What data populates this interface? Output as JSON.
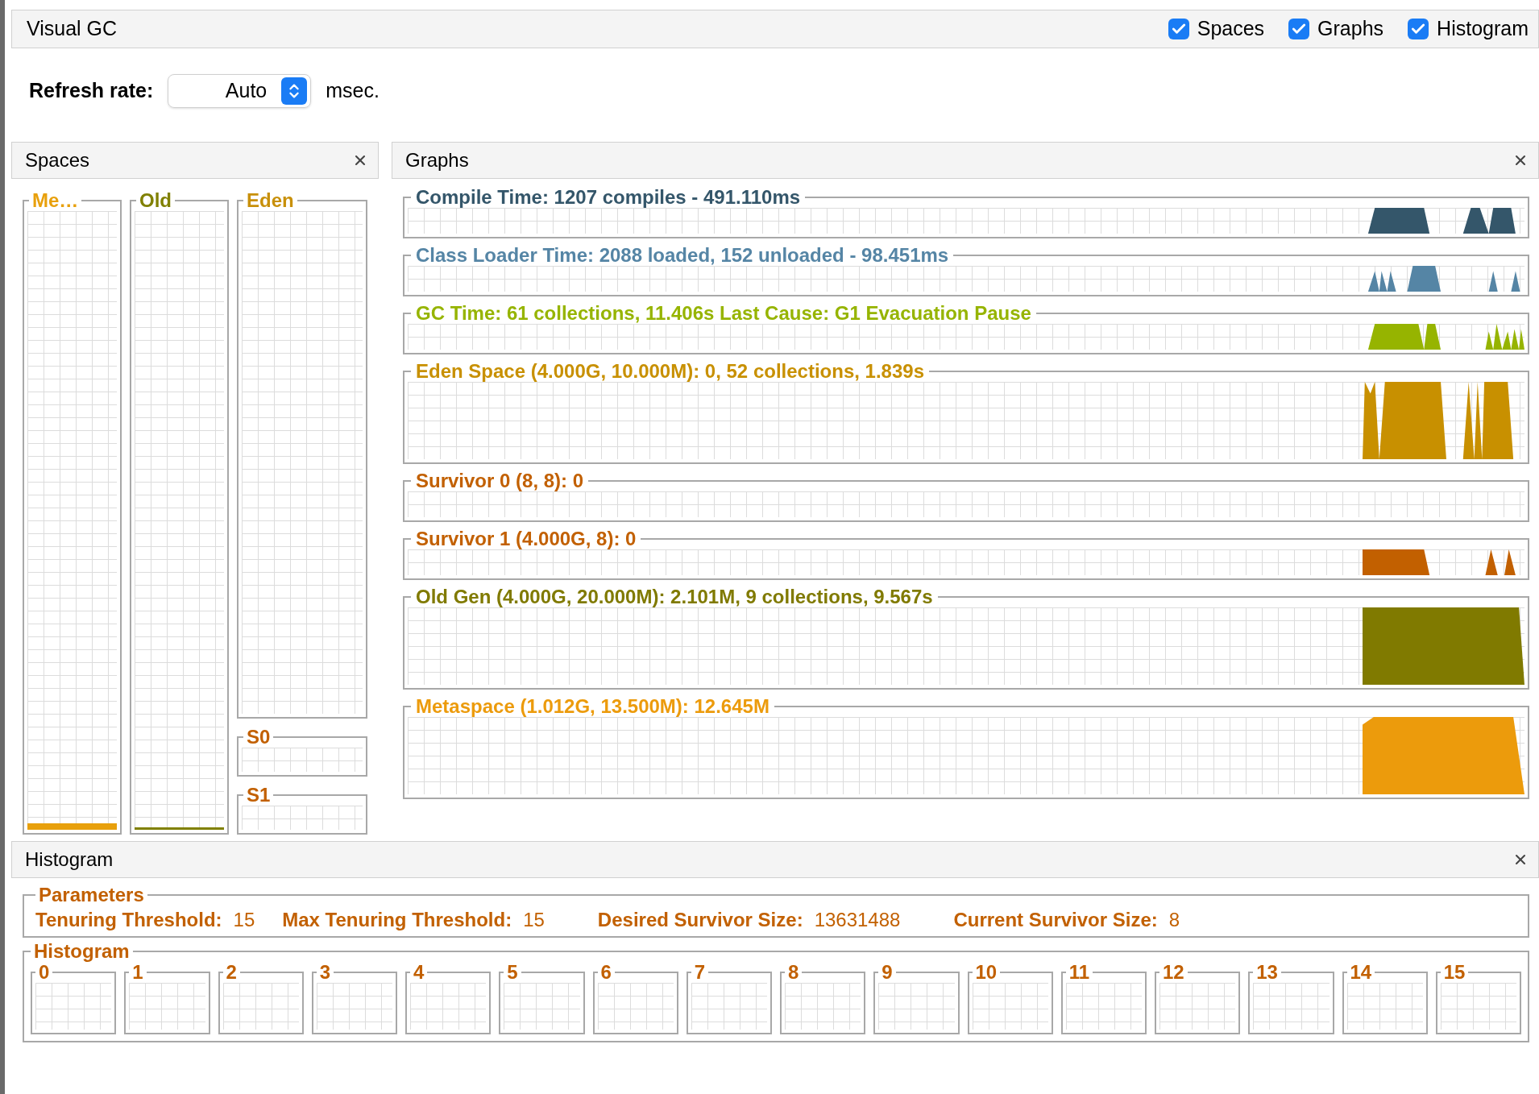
{
  "window": {
    "title": "Visual GC"
  },
  "view_toggles": [
    {
      "label": "Spaces",
      "checked": true
    },
    {
      "label": "Graphs",
      "checked": true
    },
    {
      "label": "Histogram",
      "checked": true
    }
  ],
  "refresh": {
    "label": "Refresh rate:",
    "value": "Auto",
    "unit": "msec."
  },
  "spaces": {
    "title": "Spaces",
    "columns": [
      {
        "name": "Me…",
        "color": "#e8a00c",
        "level": 0.01
      },
      {
        "name": "Old",
        "color": "#808000",
        "level": 0.003
      }
    ],
    "stacked": [
      {
        "name": "Eden",
        "color": "#c8900a"
      },
      {
        "name": "S0",
        "color": "#c26000"
      },
      {
        "name": "S1",
        "color": "#c26000"
      }
    ]
  },
  "graphs": {
    "title": "Graphs",
    "items": [
      {
        "title": "Compile Time: 1207 compiles - 491.110ms",
        "color": "#34566a",
        "kind": "compact"
      },
      {
        "title": "Class Loader Time: 2088 loaded, 152 unloaded - 98.451ms",
        "color": "#5585a5",
        "kind": "compact"
      },
      {
        "title": "GC Time: 61 collections, 11.406s  Last Cause: G1 Evacuation Pause",
        "color": "#96b400",
        "kind": "compact"
      },
      {
        "title": "Eden Space (4.000G, 10.000M): 0, 52 collections, 1.839s",
        "color": "#c89000",
        "kind": "large"
      },
      {
        "title": "Survivor 0 (8, 8): 0",
        "color": "#c26000",
        "kind": "compact"
      },
      {
        "title": "Survivor 1 (4.000G, 8): 0",
        "color": "#c26000",
        "kind": "compact"
      },
      {
        "title": "Old Gen (4.000G, 20.000M): 2.101M, 9 collections, 9.567s",
        "color": "#807a00",
        "kind": "large"
      },
      {
        "title": "Metaspace (1.012G, 13.500M): 12.645M",
        "color": "#ec9b0c",
        "kind": "large"
      }
    ]
  },
  "histogram": {
    "title": "Histogram",
    "parameters_title": "Parameters",
    "parameters": [
      {
        "label": "Tenuring Threshold:",
        "value": "15"
      },
      {
        "label": "Max Tenuring Threshold:",
        "value": "15"
      },
      {
        "label": "Desired Survivor Size:",
        "value": "13631488"
      },
      {
        "label": "Current Survivor Size:",
        "value": "8"
      }
    ],
    "histogram_title": "Histogram",
    "ages": [
      "0",
      "1",
      "2",
      "3",
      "4",
      "5",
      "6",
      "7",
      "8",
      "9",
      "10",
      "11",
      "12",
      "13",
      "14",
      "15"
    ]
  }
}
